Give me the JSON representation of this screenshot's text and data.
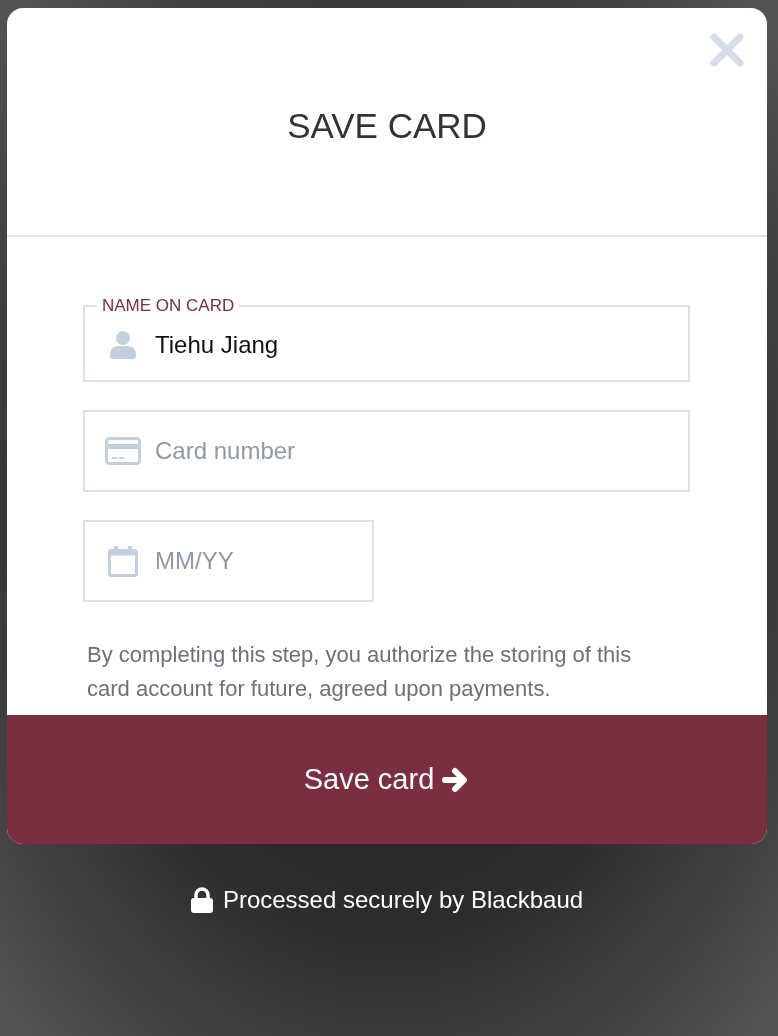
{
  "dialog": {
    "title": "SAVE CARD",
    "fields": [
      {
        "kind": "name",
        "label": "NAME ON CARD",
        "value": "Tiehu Jiang"
      },
      {
        "kind": "card",
        "placeholder": "Card number"
      },
      {
        "kind": "expiry",
        "placeholder": "MM/YY"
      }
    ],
    "notice": "By completing this step, you authorize the storing of this card account for future, agreed upon payments.",
    "submit_button": "Save card"
  },
  "footer": "Processed securely by Blackbaud"
}
